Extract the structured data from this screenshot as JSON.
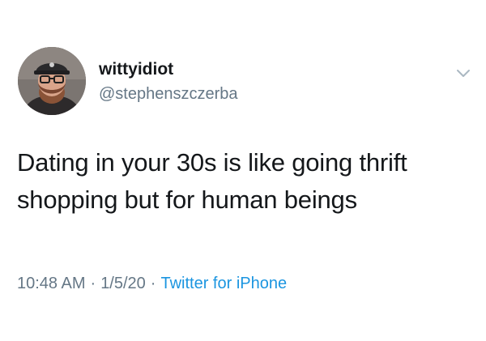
{
  "author": {
    "display_name": "wittyidiot",
    "handle": "@stephenszczerba"
  },
  "tweet": {
    "text_line1": "Dating in your 30s is like going thrift",
    "text_line2": "shopping but for human beings"
  },
  "meta": {
    "time": "10:48 AM",
    "separator": "·",
    "date": "1/5/20",
    "source": "Twitter for iPhone"
  },
  "icons": {
    "caret": "chevron-down-icon",
    "avatar": "avatar"
  },
  "colors": {
    "text": "#14171a",
    "secondary": "#657786",
    "link": "#1b95e0",
    "background": "#ffffff"
  }
}
